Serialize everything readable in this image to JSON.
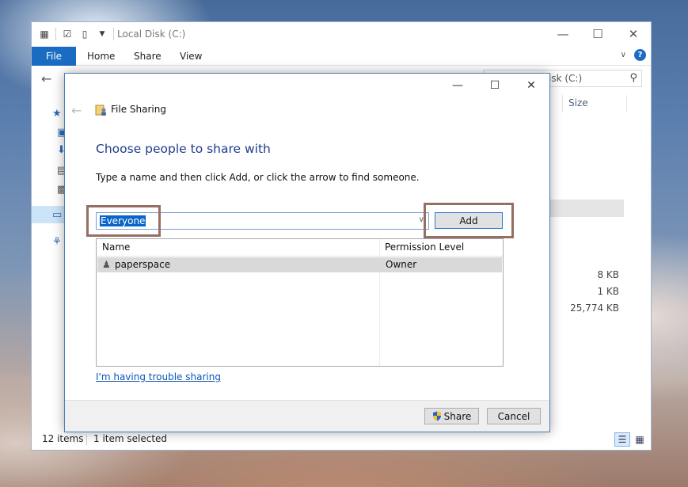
{
  "explorer": {
    "title": "Local Disk (C:)",
    "ribbon": {
      "file": "File",
      "home": "Home",
      "share": "Share",
      "view": "View"
    },
    "search_text": "isk (C:)",
    "column_size": "Size",
    "file_sizes": [
      "8 KB",
      "1 KB",
      "25,774 KB"
    ],
    "status": {
      "count": "12 items",
      "selected": "1 item selected"
    }
  },
  "dialog": {
    "title": "File Sharing",
    "heading": "Choose people to share with",
    "instruction": "Type a name and then click Add, or click the arrow to find someone.",
    "name_value": "Everyone",
    "add_label": "Add",
    "columns": {
      "name": "Name",
      "permission": "Permission Level"
    },
    "rows": [
      {
        "name": "paperspace",
        "permission": "Owner"
      }
    ],
    "trouble_link": "I'm having trouble sharing",
    "share_label": "Share",
    "cancel_label": "Cancel"
  },
  "colors": {
    "accent": "#1a6bc2",
    "heading": "#1e3c8c",
    "selection": "#0a64c8",
    "annotation_box": "#946f63"
  },
  "icons": [
    "back-arrow-icon",
    "search-icon",
    "help-icon",
    "file-sharing-icon",
    "user-icon",
    "shield-icon",
    "chevron-down-icon"
  ]
}
